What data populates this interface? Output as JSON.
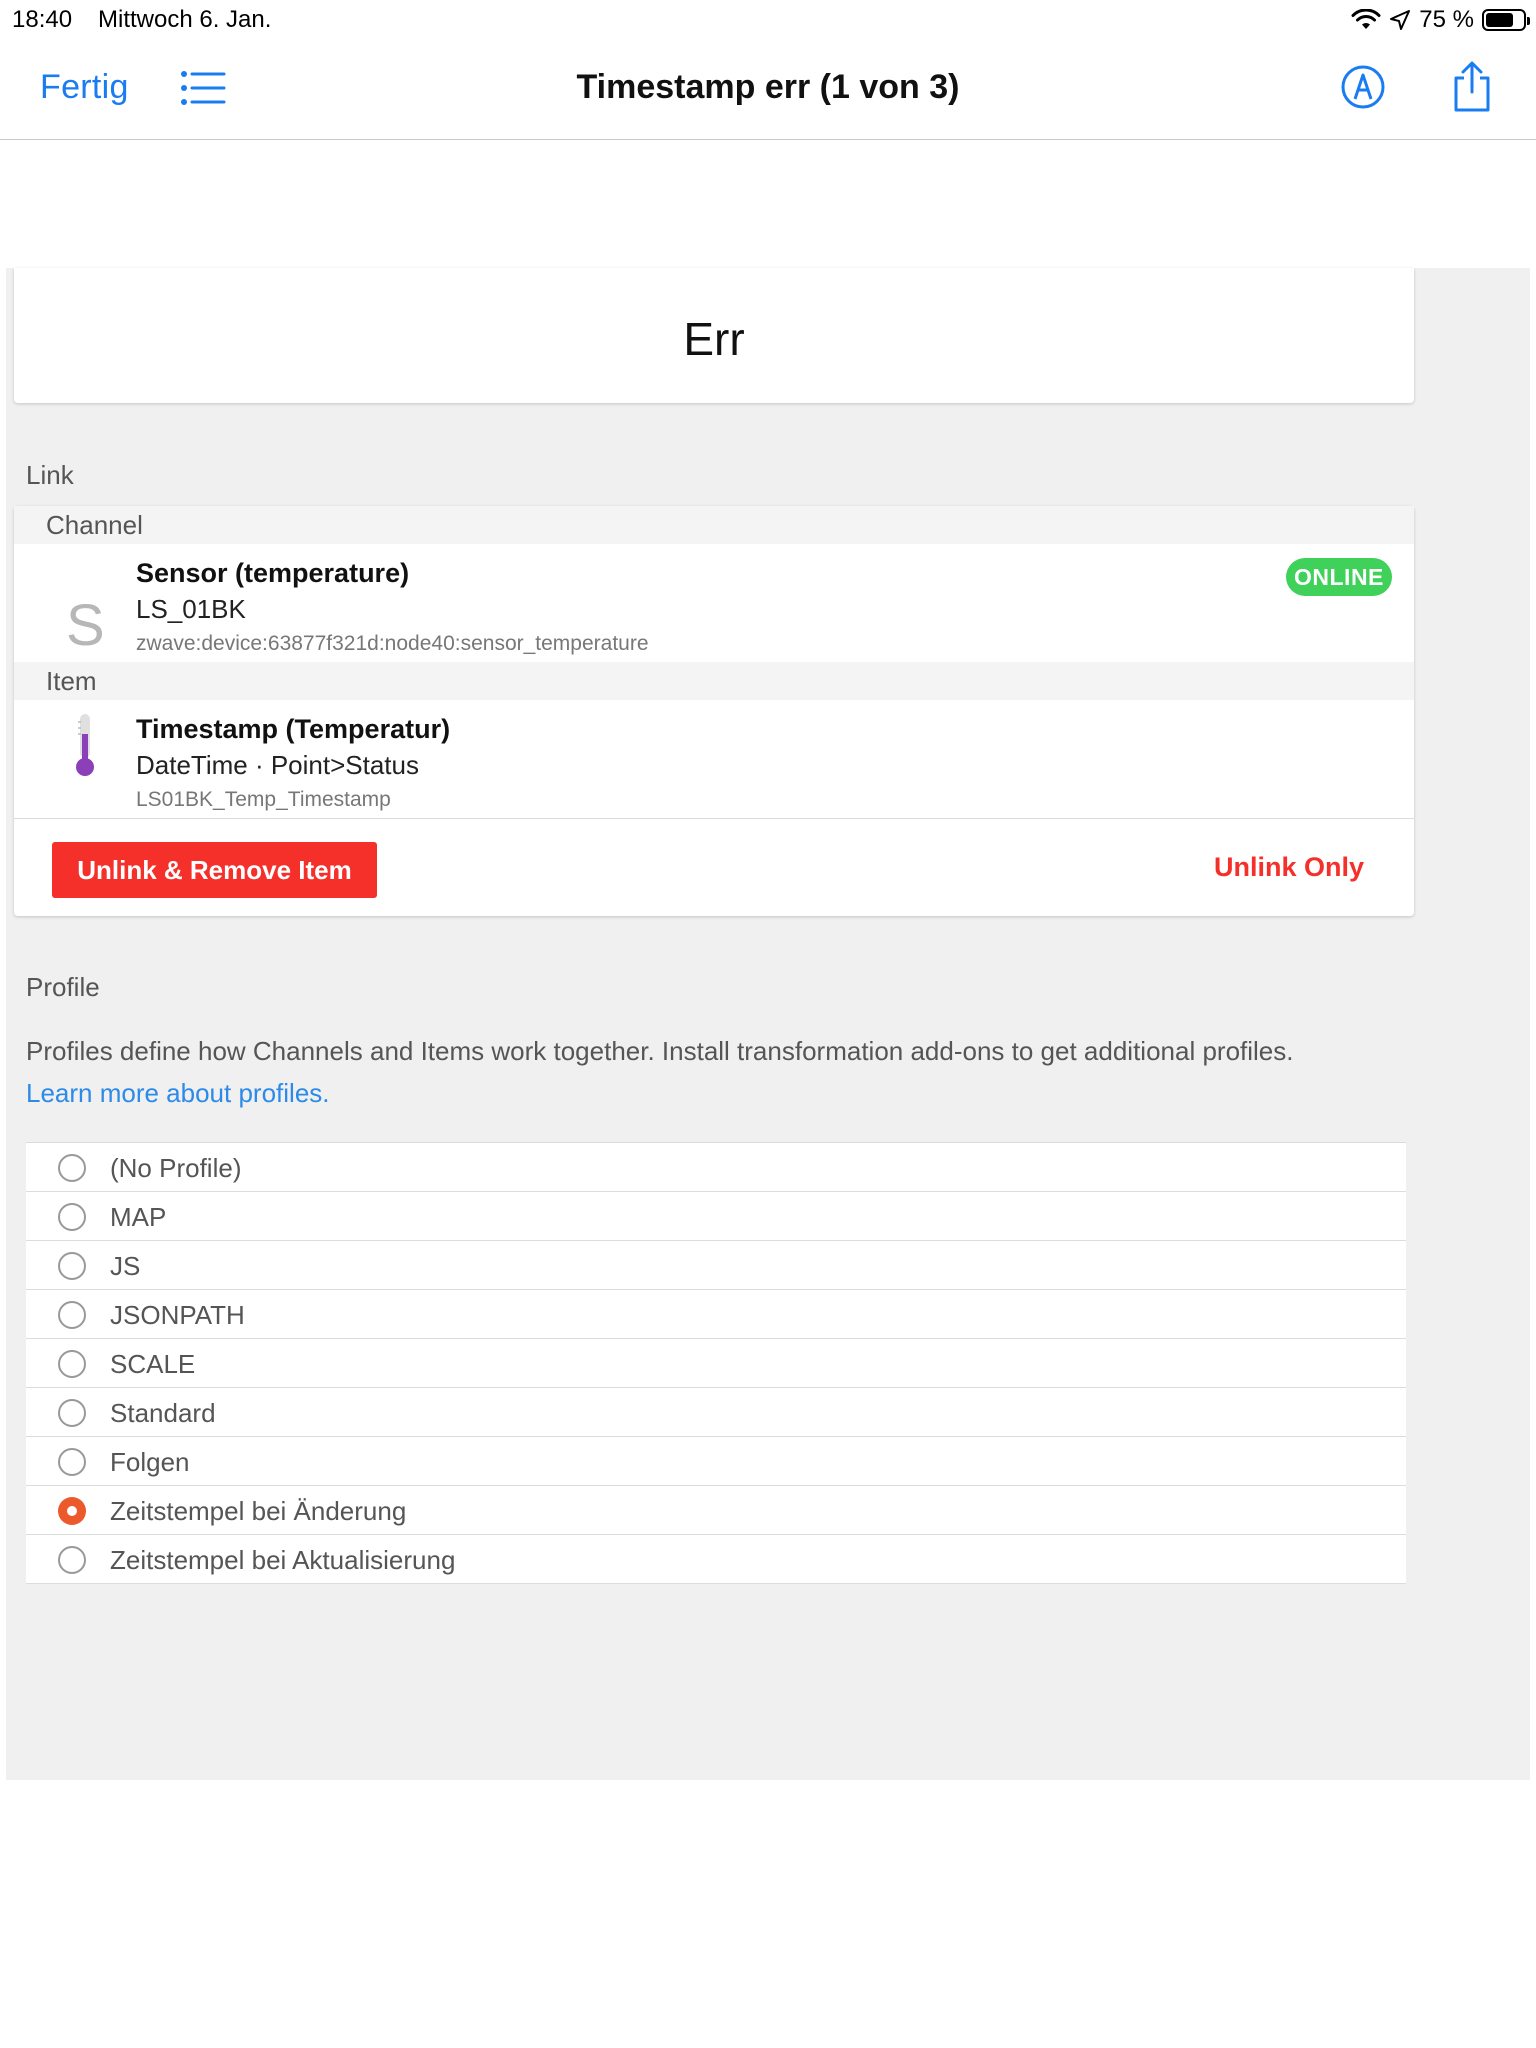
{
  "status_bar": {
    "time": "18:40",
    "date": "Mittwoch 6. Jan.",
    "battery": "75 %",
    "battery_level": 0.75
  },
  "nav": {
    "done_label": "Fertig",
    "title": "Timestamp err (1 von 3)"
  },
  "state_card": {
    "value": "Err"
  },
  "link_section": {
    "title": "Link",
    "channel_header": "Channel",
    "channel": {
      "letter": "S",
      "title": "Sensor (temperature)",
      "subtitle": "LS_01BK",
      "uid": "zwave:device:63877f321d:node40:sensor_temperature",
      "status": "ONLINE"
    },
    "item_header": "Item",
    "item": {
      "title": "Timestamp (Temperatur)",
      "subtitle": "DateTime · Point>Status",
      "name": "LS01BK_Temp_Timestamp"
    },
    "remove_button": "Unlink & Remove Item",
    "unlink_button": "Unlink Only"
  },
  "profile_section": {
    "title": "Profile",
    "description": "Profiles define how Channels and Items work together. Install transformation add-ons to get additional profiles.",
    "learn_more": "Learn more about profiles.",
    "options": [
      {
        "label": "(No Profile)",
        "checked": false
      },
      {
        "label": "MAP",
        "checked": false
      },
      {
        "label": "JS",
        "checked": false
      },
      {
        "label": "JSONPATH",
        "checked": false
      },
      {
        "label": "SCALE",
        "checked": false
      },
      {
        "label": "Standard",
        "checked": false
      },
      {
        "label": "Folgen",
        "checked": false
      },
      {
        "label": "Zeitstempel bei Änderung",
        "checked": true
      },
      {
        "label": "Zeitstempel bei Aktualisierung",
        "checked": false
      }
    ]
  },
  "colors": {
    "accent": "#1a7cf2",
    "danger": "#f5302a",
    "online": "#3fd15a",
    "radio_checked": "#ec5a2b",
    "link": "#2c8ae8"
  },
  "icons": {
    "list": "list-icon",
    "markup": "markup-pen-icon",
    "share": "share-icon",
    "wifi": "wifi-icon",
    "location": "location-arrow-icon",
    "battery": "battery-icon",
    "thermometer": "thermometer-icon"
  }
}
